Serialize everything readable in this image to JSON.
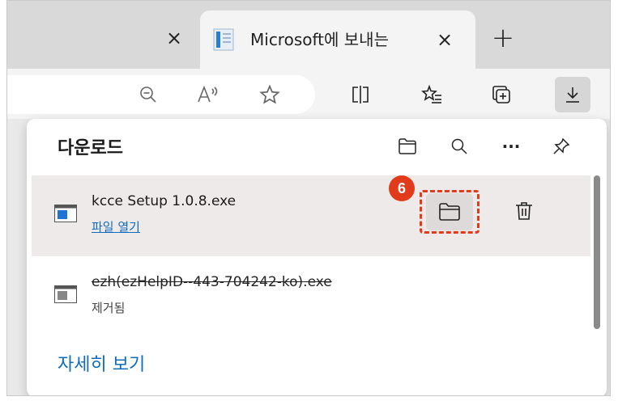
{
  "tabs": {
    "previous_close": "×",
    "active": {
      "title": "Microsoft에 보내는",
      "close": "×"
    },
    "new_tab": "+"
  },
  "toolbar": {
    "icons": [
      "zoom-out-icon",
      "read-aloud-icon",
      "favorite-star-icon",
      "split-screen-icon",
      "favorites-list-icon",
      "collections-icon",
      "download-icon"
    ]
  },
  "downloads": {
    "title": "다운로드",
    "header_icons": [
      "open-folder-icon",
      "search-icon",
      "more-icon",
      "pin-icon"
    ],
    "more_label": "···",
    "items": [
      {
        "name": "kcce Setup 1.0.8.exe",
        "action": "파일 열기",
        "step": "6"
      },
      {
        "name": "ezh(ezHelpID--443-704242-ko).exe",
        "status": "제거됨"
      }
    ],
    "see_more": "자세히 보기"
  },
  "colors": {
    "accent": "#0f6cbd",
    "highlight": "#e23b1c",
    "row_selected": "#efeaea"
  }
}
